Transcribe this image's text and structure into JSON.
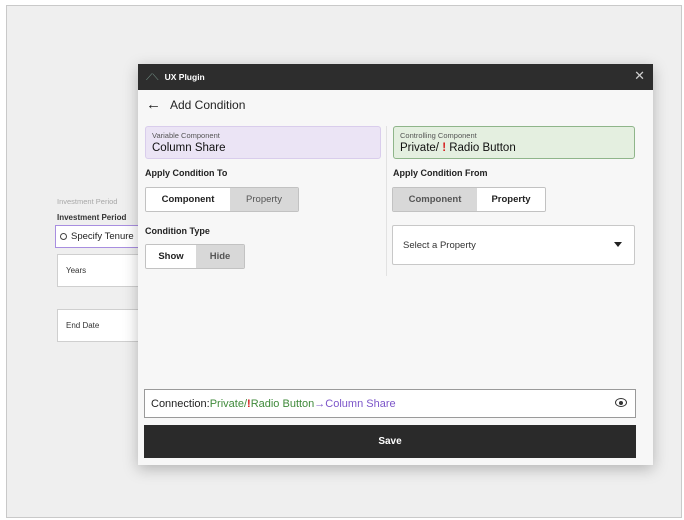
{
  "background_form": {
    "label_light": "Investment Period",
    "label": "Investment Period",
    "radio_label": "Specify Tenure",
    "field_years": "Years",
    "field_end_date": "End Date"
  },
  "modal": {
    "title": "UX Plugin",
    "close_glyph": "✕",
    "heading": "Add Condition",
    "variable_component": {
      "label": "Variable Component",
      "value": "Column Share"
    },
    "controlling_component": {
      "label": "Controlling Component",
      "value_prefix": "Private/ ",
      "value_mark": "!",
      "value_suffix": " Radio Button"
    },
    "apply_to": {
      "label": "Apply Condition To",
      "options": [
        "Component",
        "Property"
      ]
    },
    "apply_from": {
      "label": "Apply Condition From",
      "options": [
        "Component",
        "Property"
      ]
    },
    "condition_type": {
      "label": "Condition Type",
      "options": [
        "Show",
        "Hide"
      ]
    },
    "property_select": {
      "value": "Select a Property"
    },
    "connection": {
      "label": "Connection: ",
      "from_prefix": "Private/ ",
      "from_mark": "!",
      "from_suffix": " Radio Button",
      "arrow": " → ",
      "to": "Column Share"
    },
    "save_label": "Save"
  },
  "colors": {
    "titlebar": "#2d2d2d",
    "variable_bg": "#ebe4f5",
    "controlling_bg": "#e4efe0",
    "accent_green": "#3f8a3a",
    "accent_purple": "#7c55c9",
    "warning_red": "#d51b1b"
  },
  "icons": [
    "plugin-logo-icon",
    "close-icon",
    "back-arrow-icon",
    "chevron-down-icon",
    "eye-icon",
    "radio-icon"
  ]
}
